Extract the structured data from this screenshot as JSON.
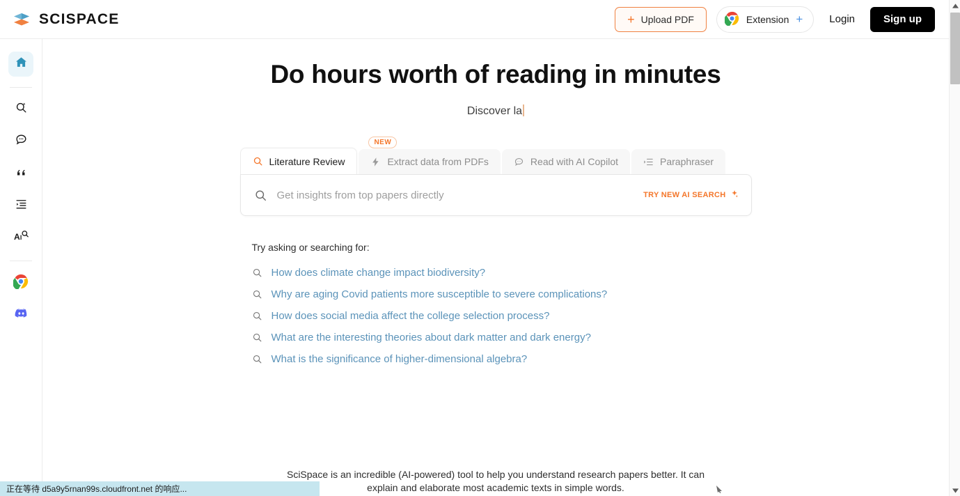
{
  "header": {
    "brand": "SCISPACE",
    "brand_logo_icon": "stacked-layers-icon",
    "upload_label": "Upload PDF",
    "upload_icon": "plus-icon",
    "extension_label": "Extension",
    "extension_icon": "chrome-icon",
    "extension_plus_icon": "plus-icon",
    "login_label": "Login",
    "signup_label": "Sign up",
    "accent_orange": "#f4762a",
    "accent_blue": "#4a90e2"
  },
  "sidebar": {
    "items": [
      {
        "name": "home",
        "icon": "home-icon",
        "active": true
      },
      {
        "name": "ai-search",
        "icon": "search-sparkle-icon",
        "active": false
      },
      {
        "name": "chat",
        "icon": "chat-bubble-icon",
        "active": false
      },
      {
        "name": "citations",
        "icon": "quote-icon",
        "active": false
      },
      {
        "name": "outline",
        "icon": "list-indent-icon",
        "active": false
      },
      {
        "name": "ai-detector",
        "icon": "ai-magnifier-icon",
        "active": false
      },
      {
        "name": "chrome-extension",
        "icon": "chrome-icon",
        "active": false
      },
      {
        "name": "discord",
        "icon": "discord-icon",
        "active": false
      }
    ]
  },
  "main": {
    "title": "Do hours worth of reading in minutes",
    "subtitle": "Discover la",
    "tabs": [
      {
        "label": "Literature Review",
        "icon": "search-icon",
        "active": true,
        "badge": ""
      },
      {
        "label": "Extract data from PDFs",
        "icon": "lightning-icon",
        "active": false,
        "badge": "NEW"
      },
      {
        "label": "Read with AI Copilot",
        "icon": "chat-bubble-icon",
        "active": false,
        "badge": ""
      },
      {
        "label": "Paraphraser",
        "icon": "list-indent-icon",
        "active": false,
        "badge": ""
      }
    ],
    "search": {
      "placeholder": "Get insights from top papers directly",
      "value": "",
      "icon": "search-icon",
      "try_ai_label": "TRY NEW AI SEARCH",
      "try_ai_icon": "sparkle-icon"
    },
    "suggestions_title": "Try asking or searching for:",
    "suggestions": [
      "How does climate change impact biodiversity?",
      "Why are aging Covid patients more susceptible to severe complications?",
      "How does social media affect the college selection process?",
      "What are the interesting theories about dark matter and dark energy?",
      "What is the significance of higher-dimensional algebra?"
    ],
    "blurb_line1": "SciSpace is an incredible (AI-powered) tool to help you understand research papers better. It can",
    "blurb_line2": "explain and elaborate most academic texts in simple words."
  },
  "statusbar": {
    "text": "正在等待 d5a9y5rnan99s.cloudfront.net 的响应..."
  },
  "scrollbar": {
    "up_icon": "chevron-up-icon",
    "down_icon": "chevron-down-icon"
  }
}
